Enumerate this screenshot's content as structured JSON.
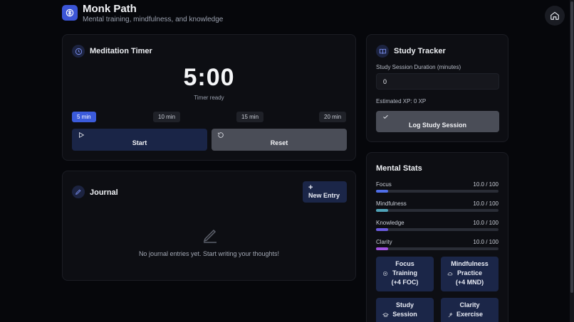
{
  "header": {
    "title": "Monk Path",
    "subtitle": "Mental training, mindfulness, and knowledge",
    "logo_icon": "brain-icon",
    "home_icon": "home-icon"
  },
  "timer": {
    "title": "Meditation Timer",
    "icon": "clock-icon",
    "display": "5:00",
    "status": "Timer ready",
    "presets": [
      "5 min",
      "10 min",
      "15 min",
      "20 min"
    ],
    "active_preset": "5 min",
    "start_label": "Start",
    "reset_label": "Reset"
  },
  "journal": {
    "title": "Journal",
    "icon": "pencil-icon",
    "new_entry_plus": "+",
    "new_entry_label": "New Entry",
    "empty_text": "No journal entries yet. Start writing your thoughts!"
  },
  "study": {
    "title": "Study Tracker",
    "icon": "book-icon",
    "duration_label": "Study Session Duration (minutes)",
    "duration_value": "0",
    "xp_text": "Estimated XP: 0 XP",
    "log_label": "Log Study Session"
  },
  "stats": {
    "title": "Mental Stats",
    "items": [
      {
        "name": "Focus",
        "value": "10.0 / 100",
        "fraction": 0.1,
        "color": "#4f6ee8"
      },
      {
        "name": "Mindfulness",
        "value": "10.0 / 100",
        "fraction": 0.1,
        "color": "#4fa3b8"
      },
      {
        "name": "Knowledge",
        "value": "10.0 / 100",
        "fraction": 0.1,
        "color": "#6a5be0"
      },
      {
        "name": "Clarity",
        "value": "10.0 / 100",
        "fraction": 0.1,
        "color": "#a052e0"
      }
    ],
    "actions": [
      {
        "l1": "Focus",
        "l2": "Training",
        "l3": "(+4 FOC)"
      },
      {
        "l1": "Mindfulness",
        "l2": "Practice",
        "l3": "(+4 MND)"
      },
      {
        "l1": "Study",
        "l2": "Session"
      },
      {
        "l1": "Clarity",
        "l2": "Exercise"
      }
    ]
  },
  "colors": {
    "accent": "#3b5bdb",
    "background": "#06070b",
    "card": "#0d0e13"
  }
}
